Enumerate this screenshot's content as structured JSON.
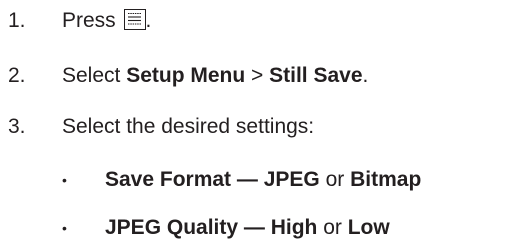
{
  "steps": [
    {
      "num": "1.",
      "prefix": "Press",
      "icon": "menu-icon",
      "suffix": "."
    },
    {
      "num": "2.",
      "prefix": "Select ",
      "bold1": "Setup Menu",
      "sep": " > ",
      "bold2": "Still Save",
      "suffix": "."
    },
    {
      "num": "3.",
      "text": "Select the desired settings:"
    }
  ],
  "bullets": [
    {
      "dot": "•",
      "label": "Save Format",
      "dash": " — ",
      "opt1": "JPEG",
      "or": " or ",
      "opt2": "Bitmap"
    },
    {
      "dot": "•",
      "label": "JPEG Quality",
      "dash": " — ",
      "opt1": "High",
      "or": " or ",
      "opt2": "Low"
    }
  ]
}
